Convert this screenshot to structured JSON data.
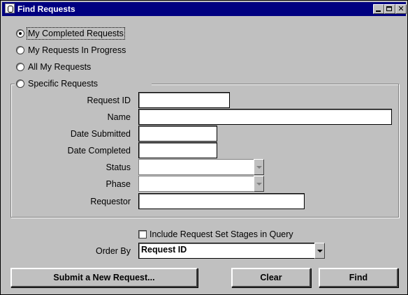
{
  "window": {
    "title": "Find Requests"
  },
  "scope": {
    "options": [
      {
        "label": "My Completed Requests",
        "checked": true
      },
      {
        "label": "My Requests In Progress",
        "checked": false
      },
      {
        "label": "All My Requests",
        "checked": false
      },
      {
        "label": "Specific Requests",
        "checked": false
      }
    ]
  },
  "specific": {
    "request_id": {
      "label": "Request ID",
      "value": ""
    },
    "name": {
      "label": "Name",
      "value": ""
    },
    "date_submitted": {
      "label": "Date Submitted",
      "value": ""
    },
    "date_completed": {
      "label": "Date Completed",
      "value": ""
    },
    "status": {
      "label": "Status",
      "value": ""
    },
    "phase": {
      "label": "Phase",
      "value": ""
    },
    "requestor": {
      "label": "Requestor",
      "value": ""
    }
  },
  "options": {
    "include_stages_label": "Include Request Set Stages in Query",
    "include_stages_checked": false,
    "order_by_label": "Order By",
    "order_by_value": "Request ID"
  },
  "buttons": {
    "submit_new": "Submit a New Request...",
    "clear": "Clear",
    "find": "Find"
  }
}
